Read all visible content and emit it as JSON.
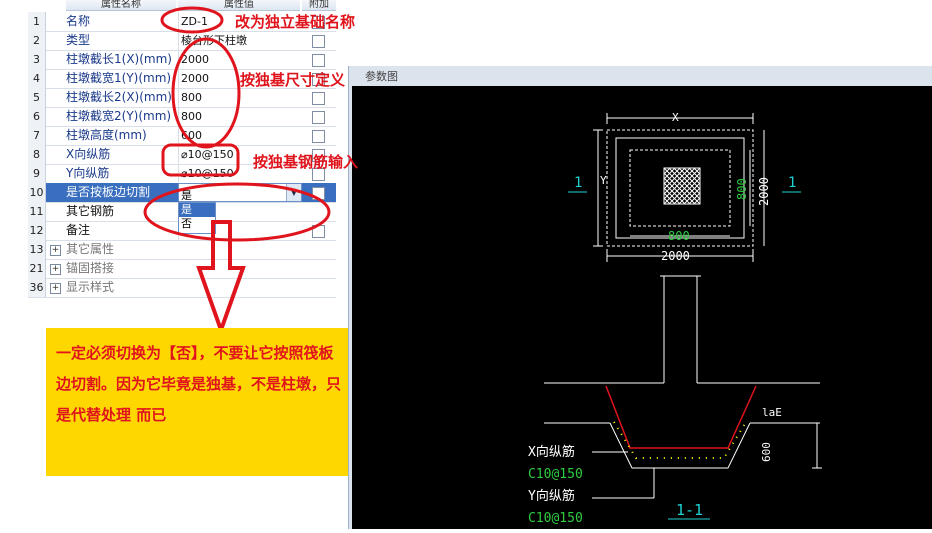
{
  "grid": {
    "header": {
      "col1": "属性名称",
      "col2": "属性值",
      "col3": "附加"
    },
    "rows": [
      {
        "num": "1",
        "name": "名称",
        "value": "ZD-1"
      },
      {
        "num": "2",
        "name": "类型",
        "value": "棱台形下柱墩"
      },
      {
        "num": "3",
        "name": "柱墩截长1(X)(mm)",
        "value": "2000"
      },
      {
        "num": "4",
        "name": "柱墩截宽1(Y)(mm)",
        "value": "2000"
      },
      {
        "num": "5",
        "name": "柱墩截长2(X)(mm)",
        "value": "800"
      },
      {
        "num": "6",
        "name": "柱墩截宽2(Y)(mm)",
        "value": "800"
      },
      {
        "num": "7",
        "name": "柱墩高度(mm)",
        "value": "600"
      },
      {
        "num": "8",
        "name": "X向纵筋",
        "value": "⌀10@150"
      },
      {
        "num": "9",
        "name": "Y向纵筋",
        "value": "⌀10@150"
      },
      {
        "num": "10",
        "name": "是否按板边切割",
        "value": "是"
      },
      {
        "num": "11",
        "name": "其它钢筋",
        "value": ""
      },
      {
        "num": "12",
        "name": "备注",
        "value": ""
      },
      {
        "num": "13",
        "name": "其它属性",
        "value": ""
      },
      {
        "num": "21",
        "name": "锚固搭接",
        "value": ""
      },
      {
        "num": "36",
        "name": "显示样式",
        "value": ""
      }
    ],
    "dropdown_options": [
      "是",
      "否"
    ]
  },
  "view": {
    "title": "参数图",
    "labels": {
      "x": "X",
      "y": "Y",
      "d800a": "800",
      "d2000a": "2000",
      "d800b": "800",
      "d2000b": "2000",
      "sec1": "1",
      "sec2": "1",
      "lae": "laE",
      "d600": "600",
      "xbar": "X向纵筋",
      "xbar_val": "C10@150",
      "ybar": "Y向纵筋",
      "ybar_val": "C10@150",
      "section": "1-1"
    }
  },
  "annotations": {
    "a1": "改为独立基础名称",
    "a2": "按独基尺寸定义",
    "a3": "按独基钢筋输入",
    "note": "一定必须切换为【否】，不要让它按照筏板边切割。因为它毕竟是独基，不是柱墩，只是代替处理 而已"
  },
  "colors": {
    "annotation_red": "#e0141c",
    "note_bg": "#ffd700",
    "cad_green": "#2ecc40",
    "cad_cyan": "#20d0d0"
  }
}
